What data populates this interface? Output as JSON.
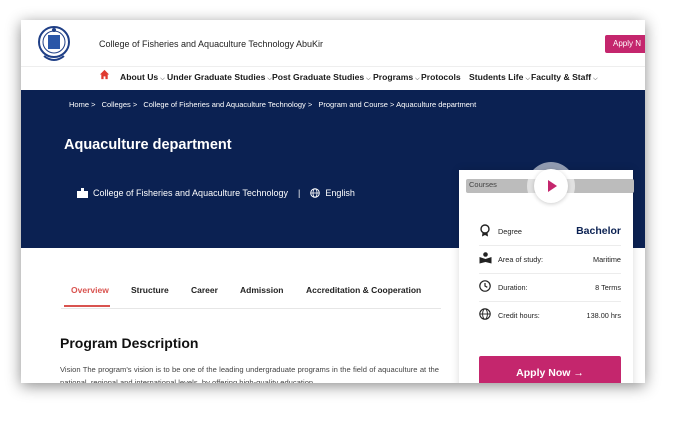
{
  "header": {
    "college_name": "College of Fisheries and Aquaculture Technology  AbuKir",
    "apply_label": "Apply N"
  },
  "nav": {
    "items": [
      {
        "label": "About Us",
        "has_dropdown": true
      },
      {
        "label": "Under Graduate Studies",
        "has_dropdown": true
      },
      {
        "label": "Post Graduate Studies",
        "has_dropdown": true
      },
      {
        "label": "Programs",
        "has_dropdown": true
      },
      {
        "label": "Protocols",
        "has_dropdown": false
      },
      {
        "label": "Students Life",
        "has_dropdown": true
      },
      {
        "label": "Faculty & Staff",
        "has_dropdown": true
      }
    ]
  },
  "breadcrumb": [
    "Home >",
    "Colleges >",
    "College of Fisheries and Aquaculture Technology >",
    "Program and Course > Aquaculture department"
  ],
  "hero": {
    "title": "Aquaculture department",
    "college": "College of Fisheries and Aquaculture Technology",
    "separator": "|",
    "language": "English"
  },
  "tabs": [
    "Overview",
    "Structure",
    "Career",
    "Admission",
    "Accreditation & Cooperation"
  ],
  "section": {
    "title": "Program Description",
    "text": "Vision The program's vision is to be one of the leading undergraduate programs in the field of aquaculture at the national, regional and international levels, by offering high-quality education"
  },
  "sidebar": {
    "media_alt": "Courses",
    "rows": [
      {
        "label": "Degree",
        "value": "Bachelor"
      },
      {
        "label": "Area of study:",
        "value": "Maritime"
      },
      {
        "label": "Duration:",
        "value": "8 Terms"
      },
      {
        "label": "Credit hours:",
        "value": "138.00 hrs"
      }
    ],
    "apply_label": "Apply Now →"
  },
  "colors": {
    "brand_navy": "#0b2152",
    "accent_pink": "#c4266d",
    "active_tab": "#d9534f",
    "home_icon": "#e03a2f"
  }
}
